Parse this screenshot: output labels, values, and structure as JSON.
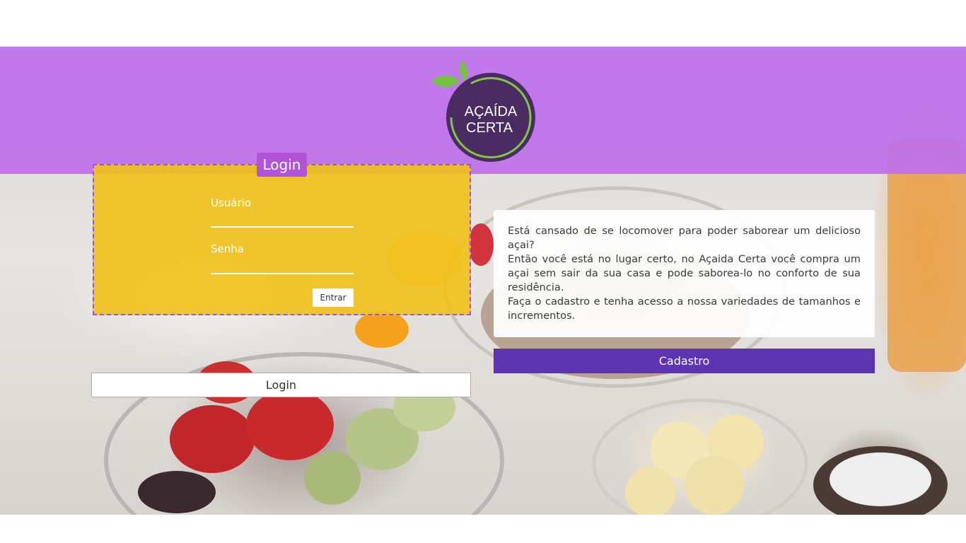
{
  "header": {
    "logo_line1": "AÇAÍDA",
    "logo_line2": "CERTA",
    "band_color": "#be70ec"
  },
  "login": {
    "tab_label": "Login",
    "username_label": "Usuário",
    "username_value": "",
    "password_label": "Senha",
    "password_value": "",
    "submit_label": "Entrar",
    "toggle_label": "Login",
    "panel_color": "#f0c11c"
  },
  "info": {
    "line1": "Está cansado de se locomover para poder saborear um delicioso açai?",
    "line2": "Então você está no lugar certo, no Açaida Certa você compra um açai sem sair da sua casa e pode saborea-lo no conforto de sua residência.",
    "line3": "Faça o cadastro e tenha acesso a nossa variedades de tamanhos e incrementos."
  },
  "signup": {
    "label": "Cadastro",
    "color": "#5e35b1"
  }
}
